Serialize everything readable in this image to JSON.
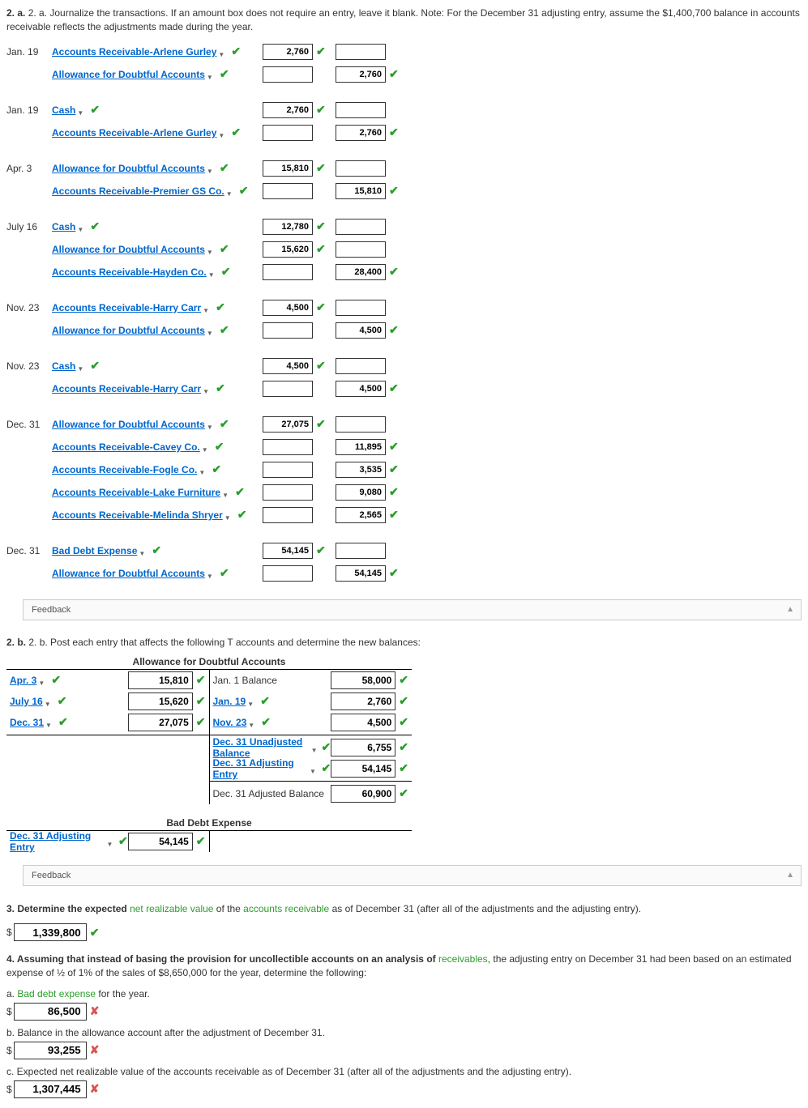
{
  "q2a": {
    "prompt": "2. a. Journalize the transactions. If an amount box does not require an entry, leave it blank. Note: For the December 31 adjusting entry, assume the $1,400,700 balance in accounts receivable reflects the adjustments made during the year.",
    "entries": [
      {
        "date": "Jan. 19",
        "lines": [
          {
            "acct": "Accounts Receivable-Arlene Gurley",
            "debit": "2,760",
            "credit": ""
          },
          {
            "acct": "Allowance for Doubtful Accounts",
            "debit": "",
            "credit": "2,760"
          }
        ]
      },
      {
        "date": "Jan. 19",
        "lines": [
          {
            "acct": "Cash",
            "debit": "2,760",
            "credit": ""
          },
          {
            "acct": "Accounts Receivable-Arlene Gurley",
            "debit": "",
            "credit": "2,760"
          }
        ]
      },
      {
        "date": "Apr. 3",
        "lines": [
          {
            "acct": "Allowance for Doubtful Accounts",
            "debit": "15,810",
            "credit": ""
          },
          {
            "acct": "Accounts Receivable-Premier GS Co.",
            "debit": "",
            "credit": "15,810"
          }
        ]
      },
      {
        "date": "July 16",
        "lines": [
          {
            "acct": "Cash",
            "debit": "12,780",
            "credit": ""
          },
          {
            "acct": "Allowance for Doubtful Accounts",
            "debit": "15,620",
            "credit": ""
          },
          {
            "acct": "Accounts Receivable-Hayden Co.",
            "debit": "",
            "credit": "28,400"
          }
        ]
      },
      {
        "date": "Nov. 23",
        "lines": [
          {
            "acct": "Accounts Receivable-Harry Carr",
            "debit": "4,500",
            "credit": ""
          },
          {
            "acct": "Allowance for Doubtful Accounts",
            "debit": "",
            "credit": "4,500"
          }
        ]
      },
      {
        "date": "Nov. 23",
        "lines": [
          {
            "acct": "Cash",
            "debit": "4,500",
            "credit": ""
          },
          {
            "acct": "Accounts Receivable-Harry Carr",
            "debit": "",
            "credit": "4,500"
          }
        ]
      },
      {
        "date": "Dec. 31",
        "lines": [
          {
            "acct": "Allowance for Doubtful Accounts",
            "debit": "27,075",
            "credit": ""
          },
          {
            "acct": "Accounts Receivable-Cavey Co.",
            "debit": "",
            "credit": "11,895"
          },
          {
            "acct": "Accounts Receivable-Fogle Co.",
            "debit": "",
            "credit": "3,535"
          },
          {
            "acct": "Accounts Receivable-Lake Furniture",
            "debit": "",
            "credit": "9,080"
          },
          {
            "acct": "Accounts Receivable-Melinda Shryer",
            "debit": "",
            "credit": "2,565"
          }
        ]
      },
      {
        "date": "Dec. 31",
        "lines": [
          {
            "acct": "Bad Debt Expense",
            "debit": "54,145",
            "credit": ""
          },
          {
            "acct": "Allowance for Doubtful Accounts",
            "debit": "",
            "credit": "54,145"
          }
        ]
      }
    ]
  },
  "feedback_label": "Feedback",
  "q2b": {
    "prompt": "2. b. Post each entry that affects the following T accounts and determine the new balances:",
    "t1": {
      "title": "Allowance for Doubtful Accounts",
      "left": [
        {
          "label": "Apr. 3",
          "link": true,
          "val": "15,810"
        },
        {
          "label": "July 16",
          "link": true,
          "val": "15,620"
        },
        {
          "label": "Dec. 31",
          "link": true,
          "val": "27,075"
        }
      ],
      "right": [
        {
          "label": "Jan. 1 Balance",
          "link": false,
          "val": "58,000"
        },
        {
          "label": "Jan. 19",
          "link": true,
          "val": "2,760"
        },
        {
          "label": "Nov. 23",
          "link": true,
          "val": "4,500"
        },
        {
          "label": "Dec. 31 Unadjusted Balance",
          "link": true,
          "val": "6,755"
        },
        {
          "label": "Dec. 31 Adjusting Entry",
          "link": true,
          "val": "54,145"
        },
        {
          "label": "Dec. 31 Adjusted Balance",
          "link": false,
          "val": "60,900"
        }
      ]
    },
    "t2": {
      "title": "Bad Debt Expense",
      "left": [
        {
          "label": "Dec. 31 Adjusting Entry",
          "link": true,
          "val": "54,145"
        }
      ],
      "right": []
    }
  },
  "q3": {
    "prompt_pre": "3.  Determine the expected ",
    "term1": "net realizable value",
    "prompt_mid": " of the ",
    "term2": "accounts receivable",
    "prompt_post": " as of December 31 (after all of the adjustments and the adjusting entry).",
    "value": "1,339,800",
    "mark": "check"
  },
  "q4": {
    "prompt_pre": "4.  Assuming that instead of basing the provision for uncollectible accounts on an analysis of ",
    "term": "receivables",
    "prompt_post": ", the adjusting entry on December 31 had been based on an estimated expense of ½ of 1% of the sales of $8,650,000 for the year, determine the following:",
    "a": {
      "label_pre": "a.  ",
      "term": "Bad debt expense",
      "label_post": " for the year.",
      "value": "86,500",
      "mark": "cross"
    },
    "b": {
      "label": "b.  Balance in the allowance account after the adjustment of December 31.",
      "value": "93,255",
      "mark": "cross"
    },
    "c": {
      "label": "c.  Expected net realizable value of the accounts receivable as of December 31 (after all of the adjustments and the adjusting entry).",
      "value": "1,307,445",
      "mark": "cross"
    }
  }
}
